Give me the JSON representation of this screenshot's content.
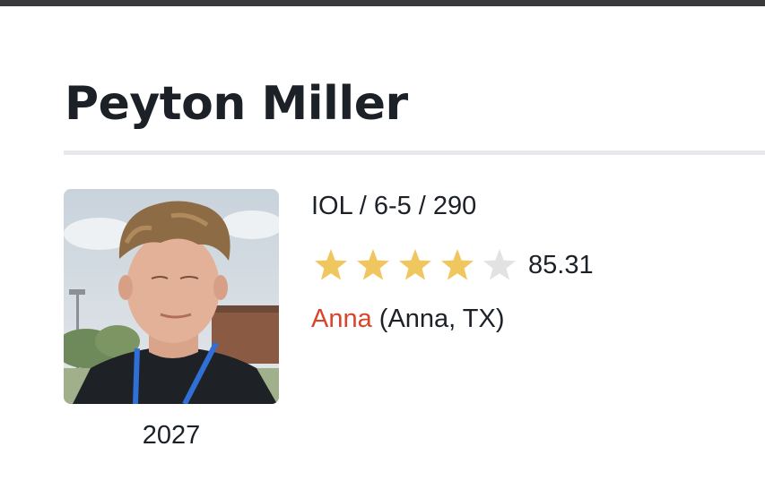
{
  "player": {
    "name": "Peyton Miller",
    "class_year": "2027",
    "bio": "IOL / 6-5 / 290",
    "stars": 4,
    "max_stars": 5,
    "rating": "85.31",
    "school": "Anna",
    "hometown": "(Anna, TX)"
  },
  "colors": {
    "star_filled": "#f0c75e",
    "star_empty": "#e2e2e2",
    "school_link": "#d9452c",
    "text": "#1b2127"
  },
  "icons": {
    "star": "star-icon"
  }
}
